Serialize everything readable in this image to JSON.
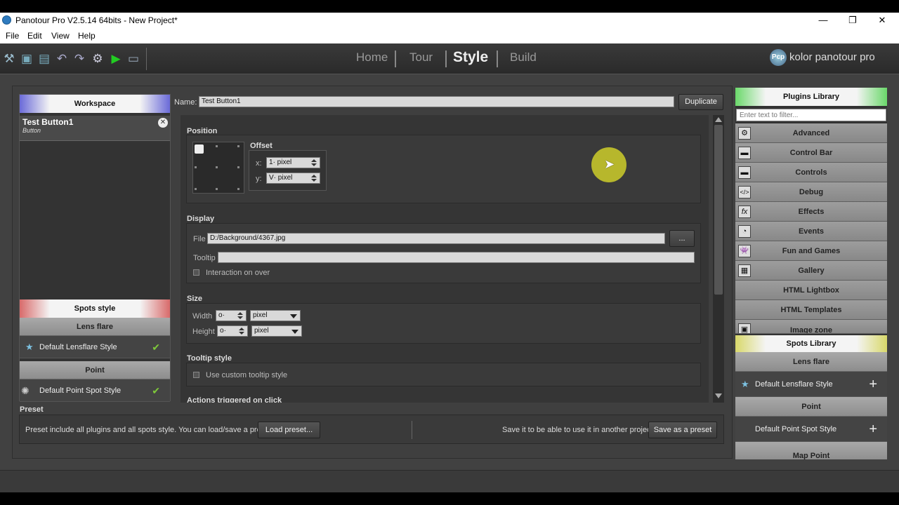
{
  "window": {
    "title": "Panotour Pro V2.5.14 64bits - New Project*"
  },
  "menu": [
    "File",
    "Edit",
    "View",
    "Help"
  ],
  "nav": {
    "home": "Home",
    "tour": "Tour",
    "style": "Style",
    "build": "Build"
  },
  "brand": {
    "logo": "Pcp",
    "text": "kolor panotour pro"
  },
  "workspace": {
    "header": "Workspace",
    "item_title": "Test Button1",
    "item_type": "Button"
  },
  "spots_style": {
    "header": "Spots style",
    "lensflare_header": "Lens flare",
    "lensflare_item": "Default Lensflare Style",
    "point_header": "Point",
    "point_item": "Default Point Spot Style"
  },
  "center": {
    "name_label": "Name:",
    "name_value": "Test Button1",
    "duplicate": "Duplicate",
    "position_label": "Position",
    "offset_label": "Offset",
    "x_label": "x:",
    "x_value": "1",
    "x_unit": "pixel",
    "y_label": "y:",
    "y_value": "V",
    "y_unit": "pixel",
    "display_label": "Display",
    "file_label": "File",
    "file_value": "D:/Background/4367.jpg",
    "browse": "...",
    "tooltip_label": "Tooltip",
    "tooltip_value": "",
    "interaction_label": "Interaction on over",
    "size_label": "Size",
    "width_label": "Width",
    "width_value": "o",
    "width_unit": "pixel",
    "height_label": "Height",
    "height_value": "o",
    "height_unit": "pixel",
    "tooltip_style_label": "Tooltip style",
    "custom_tooltip_label": "Use custom tooltip style",
    "actions_label": "Actions triggered on click"
  },
  "preset": {
    "label": "Preset",
    "desc": "Preset include all plugins and all spots style. You can load/save a preset.",
    "load": "Load preset...",
    "save_desc": "Save it to be able to use it in another project",
    "save": "Save as a preset"
  },
  "plugins": {
    "header": "Plugins Library",
    "filter_placeholder": "Enter text to filter...",
    "items": [
      {
        "label": "Advanced",
        "icon": "gear-icon",
        "glyph": "⚙"
      },
      {
        "label": "Control Bar",
        "icon": "control-bar-icon",
        "glyph": "▬"
      },
      {
        "label": "Controls",
        "icon": "controls-icon",
        "glyph": "▬"
      },
      {
        "label": "Debug",
        "icon": "code-icon",
        "glyph": "</>"
      },
      {
        "label": "Effects",
        "icon": "fx-icon",
        "glyph": "fx"
      },
      {
        "label": "Events",
        "icon": "events-icon",
        "glyph": "◔"
      },
      {
        "label": "Fun and Games",
        "icon": "game-icon",
        "glyph": "👾"
      },
      {
        "label": "Gallery",
        "icon": "gallery-icon",
        "glyph": "▦"
      },
      {
        "label": "HTML Lightbox",
        "icon": "",
        "glyph": ""
      },
      {
        "label": "HTML Templates",
        "icon": "",
        "glyph": ""
      },
      {
        "label": "Image zone",
        "icon": "image-zone-icon",
        "glyph": "▣"
      }
    ]
  },
  "spots_library": {
    "header": "Spots Library",
    "lensflare_header": "Lens flare",
    "lensflare_item": "Default Lensflare Style",
    "point_header": "Point",
    "point_item": "Default Point Spot Style",
    "mappoint_header": "Map Point"
  }
}
